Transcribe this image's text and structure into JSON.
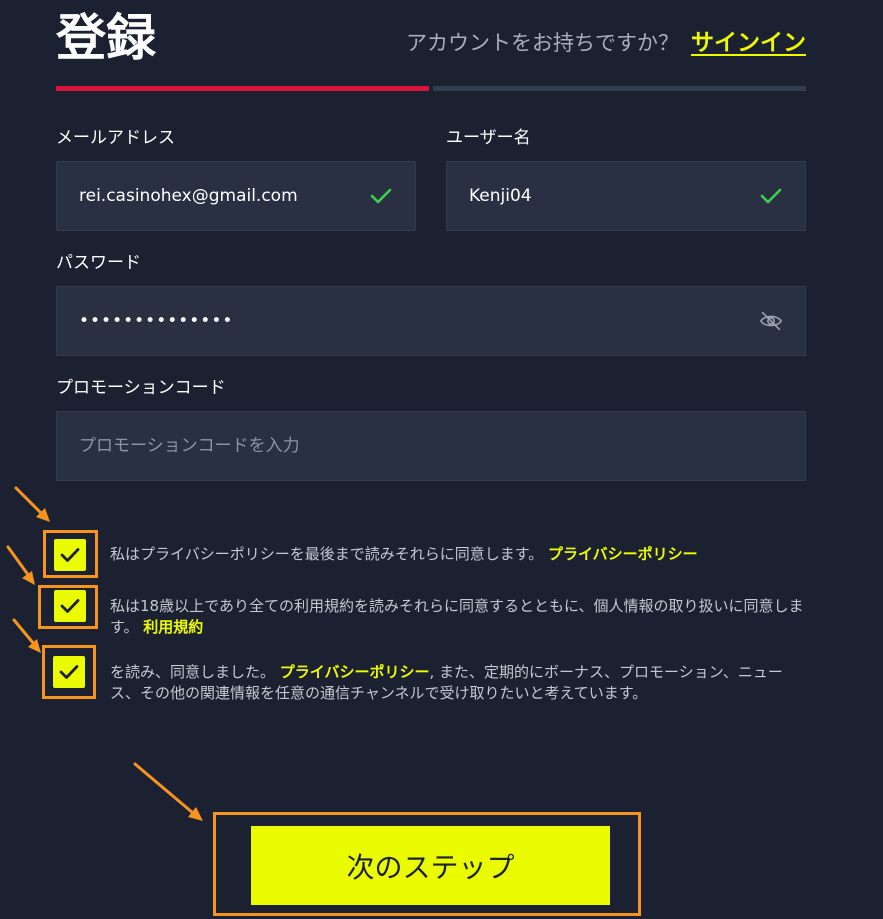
{
  "header": {
    "title": "登録",
    "signin_prompt": "アカウントをお持ちですか？",
    "signin_link": "サインイン"
  },
  "form": {
    "email": {
      "label": "メールアドレス",
      "value": "rei.casinohex@gmail.com"
    },
    "username": {
      "label": "ユーザー名",
      "value": "Kenji04"
    },
    "password": {
      "label": "パスワード",
      "value": "••••••••••••••"
    },
    "promo": {
      "label": "プロモーションコード",
      "placeholder": "プロモーションコードを入力"
    }
  },
  "agreements": {
    "privacy": {
      "text": "私はプライバシーポリシーを最後まで読みそれらに同意します。",
      "link": "プライバシーポリシー",
      "checked": true
    },
    "terms": {
      "text": "私は18歳以上であり全ての利用規約を読みそれらに同意するとともに、個人情報の取り扱いに同意します。",
      "link": "利用規約",
      "checked": true
    },
    "marketing": {
      "text_before": "を読み、同意しました。",
      "link": "プライバシーポリシー",
      "text_after": ", また、定期的にボーナス、プロモーション、ニュース、その他の関連情報を任意の通信チャンネルで受け取りたいと考えています。",
      "checked": true
    }
  },
  "actions": {
    "next_label": "次のステップ"
  },
  "colors": {
    "background": "#1b2131",
    "input_bg": "#283042",
    "accent_yellow": "#ecfc00",
    "progress_red": "#d7143a",
    "annotation_orange": "#f7941d",
    "valid_green": "#3fcf4f"
  },
  "icons": {
    "valid": "checkmark-icon",
    "password_toggle": "eye-off-icon",
    "checkbox": "checkbox-check-icon"
  }
}
